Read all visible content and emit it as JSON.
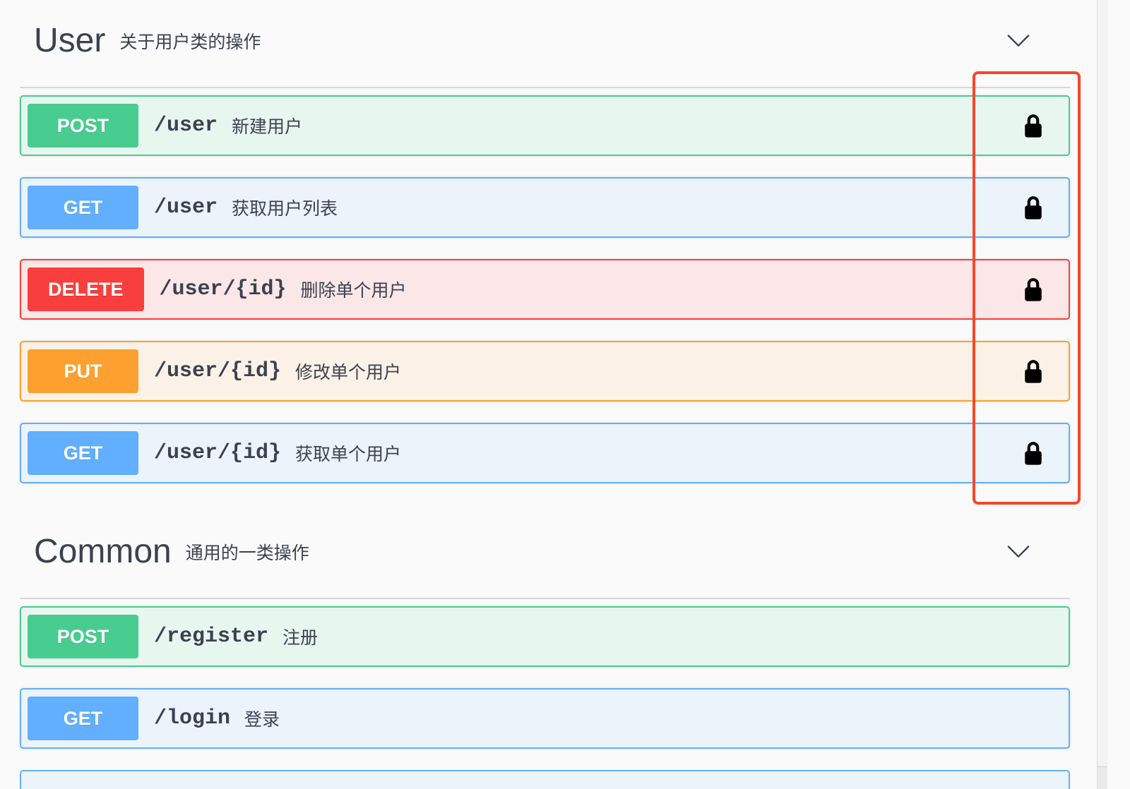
{
  "sections": [
    {
      "title": "User",
      "subtitle": "关于用户类的操作",
      "toggle_icon": "chevron-down-icon",
      "operations": [
        {
          "method": "POST",
          "path": "/user",
          "summary": "新建用户",
          "locked": true
        },
        {
          "method": "GET",
          "path": "/user",
          "summary": "获取用户列表",
          "locked": true
        },
        {
          "method": "DELETE",
          "path": "/user/{id}",
          "summary": "删除单个用户",
          "locked": true
        },
        {
          "method": "PUT",
          "path": "/user/{id}",
          "summary": "修改单个用户",
          "locked": true
        },
        {
          "method": "GET",
          "path": "/user/{id}",
          "summary": "获取单个用户",
          "locked": true
        }
      ]
    },
    {
      "title": "Common",
      "subtitle": "通用的一类操作",
      "toggle_icon": "chevron-down-icon",
      "operations": [
        {
          "method": "POST",
          "path": "/register",
          "summary": "注册",
          "locked": false
        },
        {
          "method": "GET",
          "path": "/login",
          "summary": "登录",
          "locked": false
        }
      ]
    }
  ],
  "lock_icon": "lock-icon",
  "method_colors": {
    "POST": {
      "badge": "#49cc90",
      "border": "#49cc90",
      "background": "#e8f6f0"
    },
    "GET": {
      "badge": "#61affe",
      "border": "#61affe",
      "background": "#ebf3fb"
    },
    "DELETE": {
      "badge": "#f93e3e",
      "border": "#f93e3e",
      "background": "#fbe7e7"
    },
    "PUT": {
      "badge": "#fca130",
      "border": "#fca130",
      "background": "#fbf1e6"
    }
  },
  "highlight_color": "#f4472a",
  "text_color": "#3b4151",
  "page_background": "#fafafa"
}
